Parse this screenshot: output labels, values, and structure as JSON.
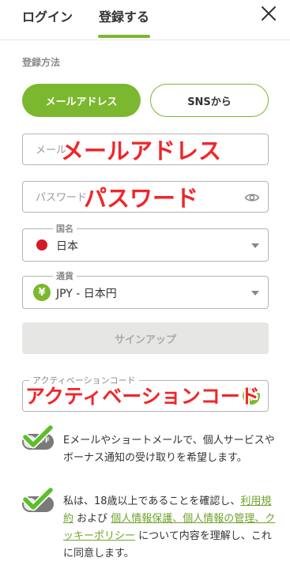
{
  "tabs": {
    "login": "ログイン",
    "register": "登録する"
  },
  "method": {
    "label": "登録方法",
    "email": "メールアドレス",
    "sns": "SNSから"
  },
  "fields": {
    "email_placeholder": "メール",
    "password_placeholder": "パスワード",
    "country_label": "国名",
    "country_value": "日本",
    "currency_label": "通貨",
    "currency_icon": "¥",
    "currency_value": "JPY - 日本円",
    "code_label": "アクティベーションコード"
  },
  "signup": {
    "label": "サインアップ"
  },
  "overlays": {
    "email": "メールアドレス",
    "password": "パスワード",
    "code": "アクティベーションコード"
  },
  "consent": {
    "toggle_state": "OFF",
    "marketing": "Eメールやショートメールで、個人サービスやボーナス通知の受け取りを希望します。",
    "terms_prefix": "私は、18歳以上であることを確認し、",
    "terms_link1": "利用規約",
    "terms_and": " および ",
    "terms_link2": "個人情報保護、個人情報の管理、クッキーポリシー",
    "terms_suffix": " について内容を理解し、これに同意します。"
  },
  "colors": {
    "accent": "#7cb82f",
    "overlay_red": "#f0262a",
    "disabled": "#e6e6e4"
  }
}
